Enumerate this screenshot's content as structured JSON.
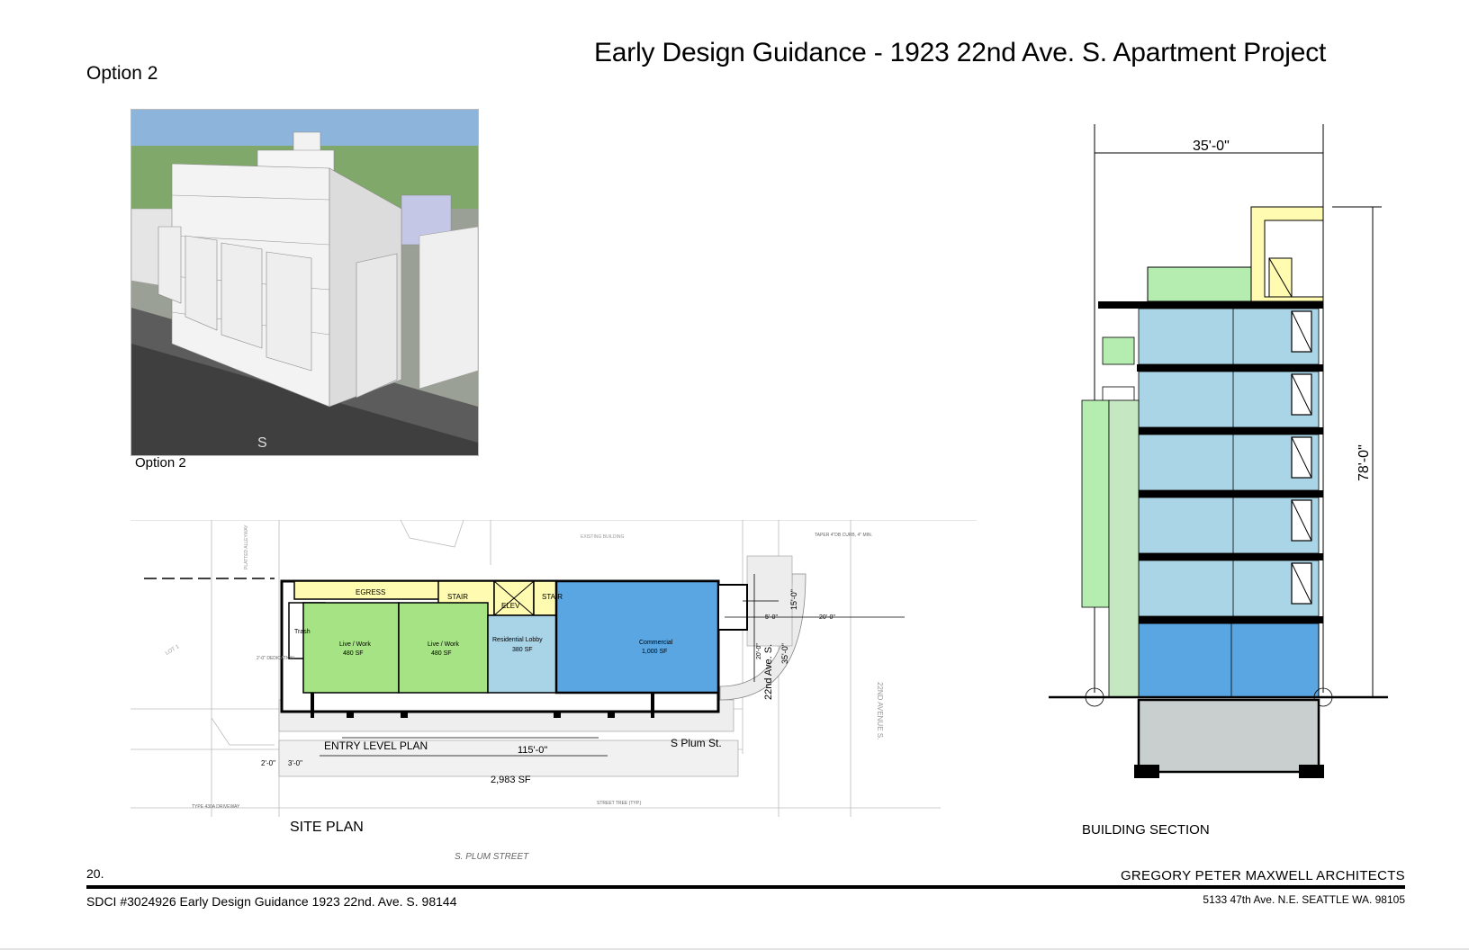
{
  "header": {
    "title": "Early Design Guidance - 1923 22nd Ave. S. Apartment Project",
    "option_label": "Option 2"
  },
  "render": {
    "caption": "Option 2",
    "street_letter": "S"
  },
  "site_plan": {
    "label": "SITE PLAN",
    "entry_label": "ENTRY LEVEL PLAN",
    "street_label": "S Plum St.",
    "avenue_label": "22nd Ave. S.",
    "avenue_name": "22ND AVENUE S.",
    "street_name": "S. PLUM STREET",
    "rooms": {
      "egress": "EGRESS",
      "stair_1": "STAIR",
      "elev": "ELEV",
      "stair_2": "STAIR",
      "trash": "Trash",
      "live_work_1": "Live / Work",
      "live_work_1_area": "480 SF",
      "live_work_2": "Live / Work",
      "live_work_2_area": "480 SF",
      "lobby": "Residential Lobby",
      "lobby_area": "380 SF",
      "commercial": "Commercial",
      "commercial_area": "1,000 SF"
    },
    "dimensions": {
      "length": "115'-0\"",
      "area": "2,983 SF",
      "left_setback": "2'-0\"",
      "left_setback_2": "3'-0\"",
      "depth": "35'-0\"",
      "side_1": "15'-0\"",
      "side_2": "20'-0\"",
      "side_3": "5'-0\"",
      "side_4": "20'-0\""
    },
    "notes": {
      "dedication": "2'-0\" DEDICATION",
      "curb_taper": "TAPER 4\"DB CURB, 4\" MIN.",
      "driveway": "TYPE 430A DRIVEWAY",
      "street_tree": "STREET TREE (TYP.)",
      "alley": "PLATTED ALLEYWAY",
      "lot": "LOT 1",
      "existing_building": "EXISTING BUILDING"
    }
  },
  "section": {
    "label": "BUILDING SECTION",
    "width_dim": "35'-0\"",
    "height_dim": "78'-0\""
  },
  "footer": {
    "page_number": "20.",
    "sdci": "SDCI #3024926 Early Design Guidance 1923 22nd. Ave. S. 98144",
    "firm_name": "GREGORY PETER MAXWELL ARCHITECTS",
    "firm_address": "5133 47th Ave.  N.E. SEATTLE WA. 98105"
  },
  "colors": {
    "live_work": "#a6e384",
    "lobby": "#a9d4e8",
    "commercial": "#5aa6e2",
    "circulation": "#fffbb0",
    "roof_green": "#b5edb1",
    "residential_blue": "#a9d5e7",
    "commercial_blue": "#5aa6e2",
    "basement_gray": "#c9cfcf",
    "render_sky": "#8db4db",
    "render_grass": "#7fa86a"
  }
}
